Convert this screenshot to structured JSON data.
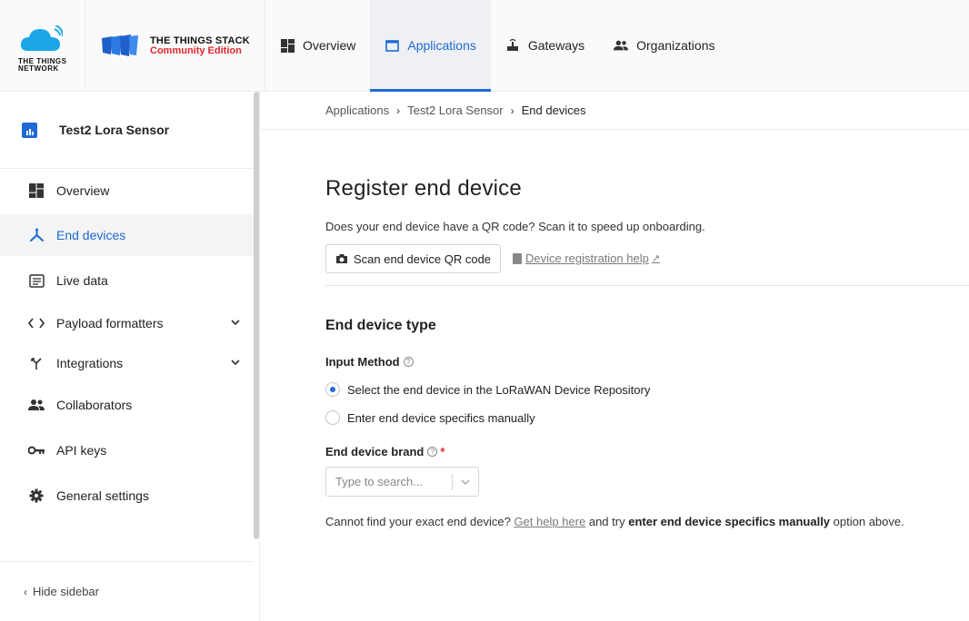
{
  "brand": {
    "tnn_line1": "THE THINGS",
    "tnn_line2": "NETWORK",
    "tts_title": "THE THINGS STACK",
    "tts_subtitle": "Community Edition"
  },
  "nav": {
    "items": [
      {
        "label": "Overview",
        "icon": "overview-grid-icon"
      },
      {
        "label": "Applications",
        "icon": "applications-window-icon",
        "active": true
      },
      {
        "label": "Gateways",
        "icon": "gateway-icon"
      },
      {
        "label": "Organizations",
        "icon": "organizations-people-icon"
      }
    ]
  },
  "sidebar": {
    "app_title": "Test2 Lora Sensor",
    "items": [
      {
        "label": "Overview",
        "icon": "overview-grid-icon"
      },
      {
        "label": "End devices",
        "icon": "end-devices-icon",
        "active": true
      },
      {
        "label": "Live data",
        "icon": "live-data-icon"
      },
      {
        "label": "Payload formatters",
        "icon": "code-brackets-icon",
        "expandable": true
      },
      {
        "label": "Integrations",
        "icon": "integrations-icon",
        "expandable": true
      },
      {
        "label": "Collaborators",
        "icon": "collaborators-icon"
      },
      {
        "label": "API keys",
        "icon": "key-icon"
      },
      {
        "label": "General settings",
        "icon": "gear-icon"
      }
    ],
    "hide_label": "Hide sidebar"
  },
  "breadcrumb": {
    "items": [
      "Applications",
      "Test2 Lora Sensor",
      "End devices"
    ]
  },
  "main": {
    "title": "Register end device",
    "qr_prompt": "Does your end device have a QR code? Scan it to speed up onboarding.",
    "scan_button": "Scan end device QR code",
    "help_link": "Device registration help",
    "section_title": "End device type",
    "input_method_label": "Input Method",
    "radio_options": [
      {
        "label": "Select the end device in the LoRaWAN Device Repository",
        "checked": true
      },
      {
        "label": "Enter end device specifics manually",
        "checked": false
      }
    ],
    "brand_label": "End device brand",
    "brand_placeholder": "Type to search...",
    "hint_prefix": "Cannot find your exact end device?",
    "hint_link": "Get help here",
    "hint_middle": "and try",
    "hint_bold": "enter end device specifics manually",
    "hint_suffix": "option above."
  },
  "colors": {
    "accent": "#1e6ad6",
    "brand_red": "#e0262c",
    "cloud_blue": "#1aa6e8"
  }
}
